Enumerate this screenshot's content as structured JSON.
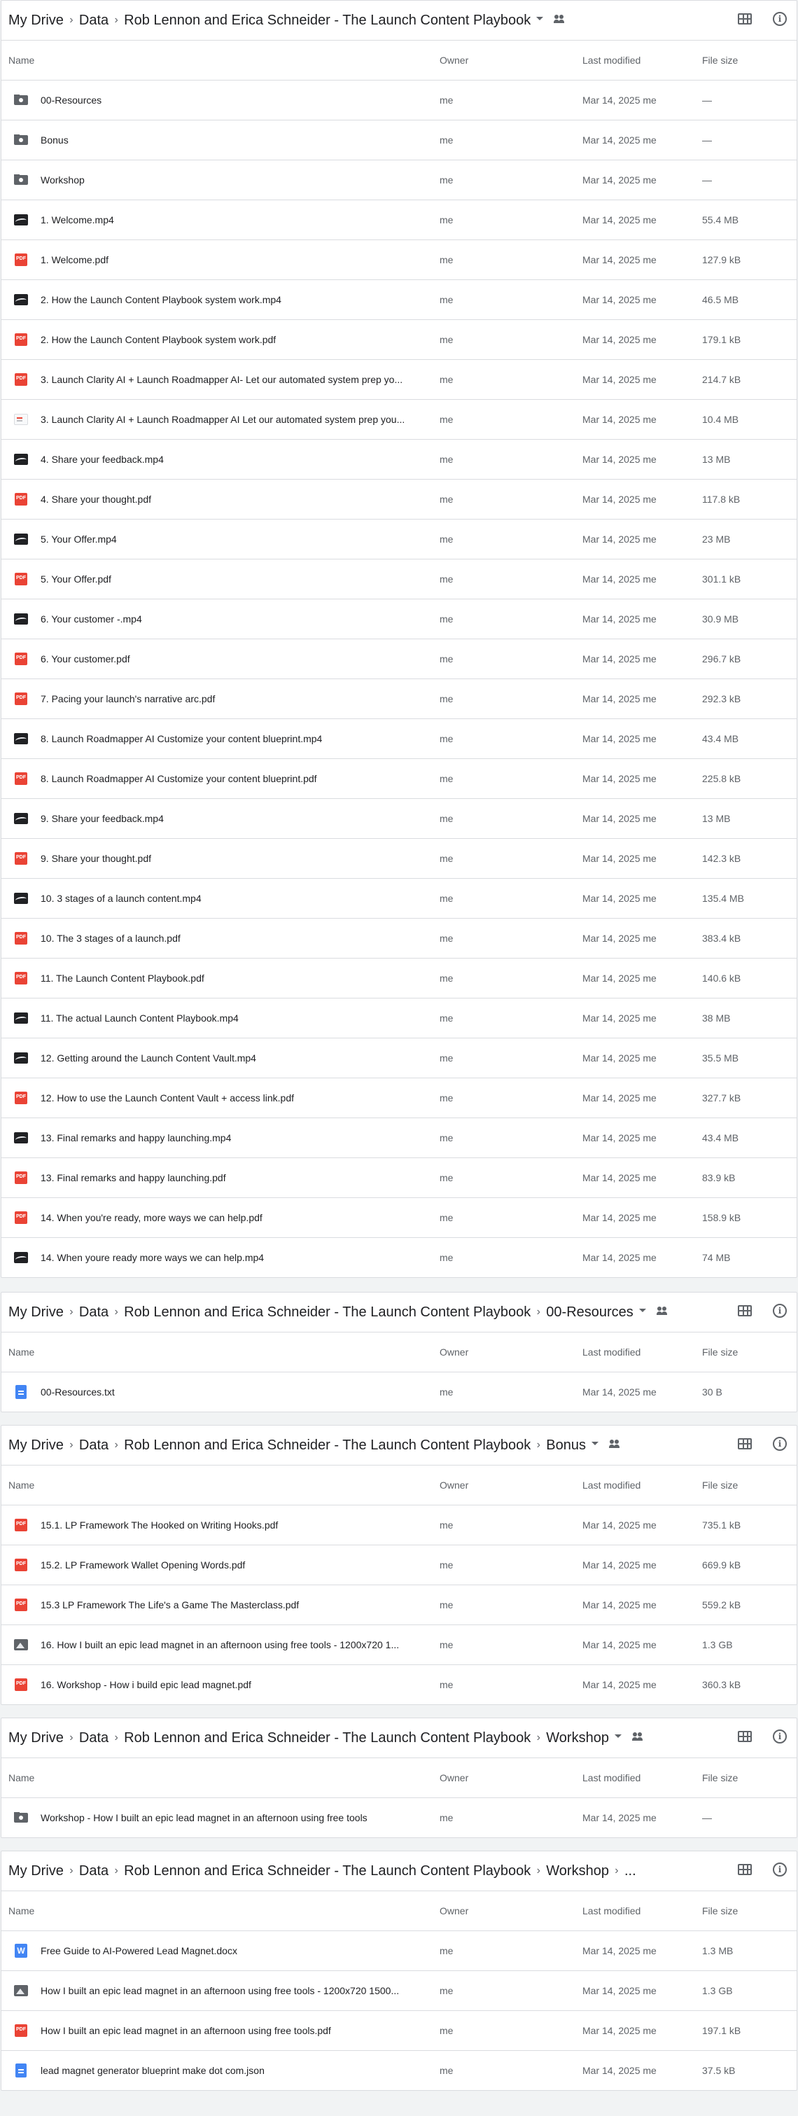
{
  "sections": [
    {
      "crumbs": [
        "My Drive",
        "Data",
        "Rob Lennon and Erica Schneider - The Launch Content Playbook"
      ],
      "shared": true,
      "caret": true,
      "headers": {
        "name": "Name",
        "owner": "Owner",
        "modified": "Last modified",
        "size": "File size"
      },
      "rows": [
        {
          "icon": "folder",
          "name": "00-Resources",
          "owner": "me",
          "modified": "Mar 14, 2025 me",
          "size": "—"
        },
        {
          "icon": "folder",
          "name": "Bonus",
          "owner": "me",
          "modified": "Mar 14, 2025 me",
          "size": "—"
        },
        {
          "icon": "folder",
          "name": "Workshop",
          "owner": "me",
          "modified": "Mar 14, 2025 me",
          "size": "—"
        },
        {
          "icon": "video",
          "name": "1. Welcome.mp4",
          "owner": "me",
          "modified": "Mar 14, 2025 me",
          "size": "55.4 MB"
        },
        {
          "icon": "pdf",
          "name": "1. Welcome.pdf",
          "owner": "me",
          "modified": "Mar 14, 2025 me",
          "size": "127.9 kB"
        },
        {
          "icon": "video",
          "name": "2. How the Launch Content Playbook system work.mp4",
          "owner": "me",
          "modified": "Mar 14, 2025 me",
          "size": "46.5 MB"
        },
        {
          "icon": "pdf",
          "name": "2. How the Launch Content Playbook system work.pdf",
          "owner": "me",
          "modified": "Mar 14, 2025 me",
          "size": "179.1 kB"
        },
        {
          "icon": "pdf",
          "name": "3. Launch Clarity AI + Launch Roadmapper AI- Let our automated system prep yo...",
          "owner": "me",
          "modified": "Mar 14, 2025 me",
          "size": "214.7 kB"
        },
        {
          "icon": "image-white",
          "name": "3. Launch Clarity AI + Launch Roadmapper AI Let our automated system prep you...",
          "owner": "me",
          "modified": "Mar 14, 2025 me",
          "size": "10.4 MB"
        },
        {
          "icon": "video",
          "name": "4. Share your feedback.mp4",
          "owner": "me",
          "modified": "Mar 14, 2025 me",
          "size": "13 MB"
        },
        {
          "icon": "pdf",
          "name": "4. Share your thought.pdf",
          "owner": "me",
          "modified": "Mar 14, 2025 me",
          "size": "117.8 kB"
        },
        {
          "icon": "video",
          "name": "5. Your Offer.mp4",
          "owner": "me",
          "modified": "Mar 14, 2025 me",
          "size": "23 MB"
        },
        {
          "icon": "pdf",
          "name": "5. Your Offer.pdf",
          "owner": "me",
          "modified": "Mar 14, 2025 me",
          "size": "301.1 kB"
        },
        {
          "icon": "video",
          "name": "6. Your customer -.mp4",
          "owner": "me",
          "modified": "Mar 14, 2025 me",
          "size": "30.9 MB"
        },
        {
          "icon": "pdf",
          "name": "6. Your customer.pdf",
          "owner": "me",
          "modified": "Mar 14, 2025 me",
          "size": "296.7 kB"
        },
        {
          "icon": "pdf",
          "name": "7. Pacing your launch's narrative arc.pdf",
          "owner": "me",
          "modified": "Mar 14, 2025 me",
          "size": "292.3 kB"
        },
        {
          "icon": "video",
          "name": "8. Launch Roadmapper AI Customize your content blueprint.mp4",
          "owner": "me",
          "modified": "Mar 14, 2025 me",
          "size": "43.4 MB"
        },
        {
          "icon": "pdf",
          "name": "8. Launch Roadmapper AI Customize your content blueprint.pdf",
          "owner": "me",
          "modified": "Mar 14, 2025 me",
          "size": "225.8 kB"
        },
        {
          "icon": "video",
          "name": "9. Share your feedback.mp4",
          "owner": "me",
          "modified": "Mar 14, 2025 me",
          "size": "13 MB"
        },
        {
          "icon": "pdf",
          "name": "9. Share your thought.pdf",
          "owner": "me",
          "modified": "Mar 14, 2025 me",
          "size": "142.3 kB"
        },
        {
          "icon": "video",
          "name": "10. 3 stages of a launch content.mp4",
          "owner": "me",
          "modified": "Mar 14, 2025 me",
          "size": "135.4 MB"
        },
        {
          "icon": "pdf",
          "name": "10. The 3 stages of a launch.pdf",
          "owner": "me",
          "modified": "Mar 14, 2025 me",
          "size": "383.4 kB"
        },
        {
          "icon": "pdf",
          "name": "11. The Launch Content Playbook.pdf",
          "owner": "me",
          "modified": "Mar 14, 2025 me",
          "size": "140.6 kB"
        },
        {
          "icon": "video",
          "name": "11. The actual Launch Content Playbook.mp4",
          "owner": "me",
          "modified": "Mar 14, 2025 me",
          "size": "38 MB"
        },
        {
          "icon": "video",
          "name": "12. Getting around the Launch Content Vault.mp4",
          "owner": "me",
          "modified": "Mar 14, 2025 me",
          "size": "35.5 MB"
        },
        {
          "icon": "pdf",
          "name": "12. How to use the Launch Content Vault + access link.pdf",
          "owner": "me",
          "modified": "Mar 14, 2025 me",
          "size": "327.7 kB"
        },
        {
          "icon": "video",
          "name": "13. Final remarks and happy launching.mp4",
          "owner": "me",
          "modified": "Mar 14, 2025 me",
          "size": "43.4 MB"
        },
        {
          "icon": "pdf",
          "name": "13. Final remarks and happy launching.pdf",
          "owner": "me",
          "modified": "Mar 14, 2025 me",
          "size": "83.9 kB"
        },
        {
          "icon": "pdf",
          "name": "14. When you're ready, more ways we can help.pdf",
          "owner": "me",
          "modified": "Mar 14, 2025 me",
          "size": "158.9 kB"
        },
        {
          "icon": "video",
          "name": "14. When youre ready more ways we can help.mp4",
          "owner": "me",
          "modified": "Mar 14, 2025 me",
          "size": "74 MB"
        }
      ]
    },
    {
      "crumbs": [
        "My Drive",
        "Data",
        "Rob Lennon and Erica Schneider - The Launch Content Playbook",
        "00-Resources"
      ],
      "shared": true,
      "caret": true,
      "headers": {
        "name": "Name",
        "owner": "Owner",
        "modified": "Last modified",
        "size": "File size"
      },
      "rows": [
        {
          "icon": "doc",
          "name": "00-Resources.txt",
          "owner": "me",
          "modified": "Mar 14, 2025 me",
          "size": "30 B"
        }
      ]
    },
    {
      "crumbs": [
        "My Drive",
        "Data",
        "Rob Lennon and Erica Schneider - The Launch Content Playbook",
        "Bonus"
      ],
      "shared": true,
      "caret": true,
      "headers": {
        "name": "Name",
        "owner": "Owner",
        "modified": "Last modified",
        "size": "File size"
      },
      "rows": [
        {
          "icon": "pdf",
          "name": "15.1. LP Framework The Hooked on Writing Hooks.pdf",
          "owner": "me",
          "modified": "Mar 14, 2025 me",
          "size": "735.1 kB"
        },
        {
          "icon": "pdf",
          "name": "15.2. LP Framework Wallet Opening Words.pdf",
          "owner": "me",
          "modified": "Mar 14, 2025 me",
          "size": "669.9 kB"
        },
        {
          "icon": "pdf",
          "name": "15.3 LP Framework The Life's a Game The Masterclass.pdf",
          "owner": "me",
          "modified": "Mar 14, 2025 me",
          "size": "559.2 kB"
        },
        {
          "icon": "image",
          "name": "16. How I built an epic lead magnet in an afternoon using free tools - 1200x720 1...",
          "owner": "me",
          "modified": "Mar 14, 2025 me",
          "size": "1.3 GB"
        },
        {
          "icon": "pdf",
          "name": "16. Workshop - How i build epic lead magnet.pdf",
          "owner": "me",
          "modified": "Mar 14, 2025 me",
          "size": "360.3 kB"
        }
      ]
    },
    {
      "crumbs": [
        "My Drive",
        "Data",
        "Rob Lennon and Erica Schneider - The Launch Content Playbook",
        "Workshop"
      ],
      "shared": true,
      "caret": true,
      "headers": {
        "name": "Name",
        "owner": "Owner",
        "modified": "Last modified",
        "size": "File size"
      },
      "rows": [
        {
          "icon": "folder",
          "name": "Workshop - How I built an epic lead magnet in an afternoon using free tools",
          "owner": "me",
          "modified": "Mar 14, 2025 me",
          "size": "—"
        }
      ]
    },
    {
      "crumbs": [
        "My Drive",
        "Data",
        "Rob Lennon and Erica Schneider - The Launch Content Playbook",
        "Workshop",
        "..."
      ],
      "shared": false,
      "caret": false,
      "headers": {
        "name": "Name",
        "owner": "Owner",
        "modified": "Last modified",
        "size": "File size"
      },
      "rows": [
        {
          "icon": "word",
          "name": "Free Guide to AI-Powered Lead Magnet.docx",
          "owner": "me",
          "modified": "Mar 14, 2025 me",
          "size": "1.3 MB"
        },
        {
          "icon": "image",
          "name": "How I built an epic lead magnet in an afternoon using free tools - 1200x720 1500...",
          "owner": "me",
          "modified": "Mar 14, 2025 me",
          "size": "1.3 GB"
        },
        {
          "icon": "pdf",
          "name": "How I built an epic lead magnet in an afternoon using free tools.pdf",
          "owner": "me",
          "modified": "Mar 14, 2025 me",
          "size": "197.1 kB"
        },
        {
          "icon": "doc",
          "name": "lead magnet generator blueprint make dot com.json",
          "owner": "me",
          "modified": "Mar 14, 2025 me",
          "size": "37.5 kB"
        }
      ]
    }
  ],
  "icons": {
    "pdf_label": "PDF",
    "word_label": "W"
  }
}
